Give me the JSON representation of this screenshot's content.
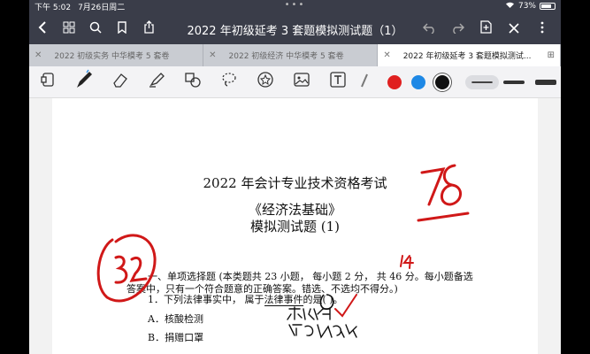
{
  "status": {
    "time": "下午 5:02",
    "date": "7月26日周二",
    "battery": "73%"
  },
  "nav": {
    "title": "2022 年初级延考 3 套题模拟测试题（1）"
  },
  "tabs": [
    {
      "label": "2022 初级实务 中华模考 5 套卷"
    },
    {
      "label": "2022 初级经济 中华模考 5 套卷"
    },
    {
      "label": "2022 年初级延考 3 套题模拟测试..."
    }
  ],
  "toolbar": {
    "colors": [
      "#e02020",
      "#1e88e5",
      "#111111"
    ]
  },
  "document": {
    "heading1": "2022 年会计专业技术资格考试",
    "heading2": "《经济法基础》",
    "heading3": "模拟测试题 (1)",
    "section_intro_1": "一、单项选择题 (本类题共 23 小题， 每小题 2 分， 共 46 分。每小题备选",
    "section_intro_2": "答案中，只有一个符合题意的正确答案。错选、不选均不得分。)",
    "q1_prefix": "1．下列法律事实中， 属于",
    "q1_underline": "法律事件",
    "q1_suffix": "的是( )。",
    "option_a": "A．核酸检测",
    "option_b": "B．捐赠口罩"
  }
}
